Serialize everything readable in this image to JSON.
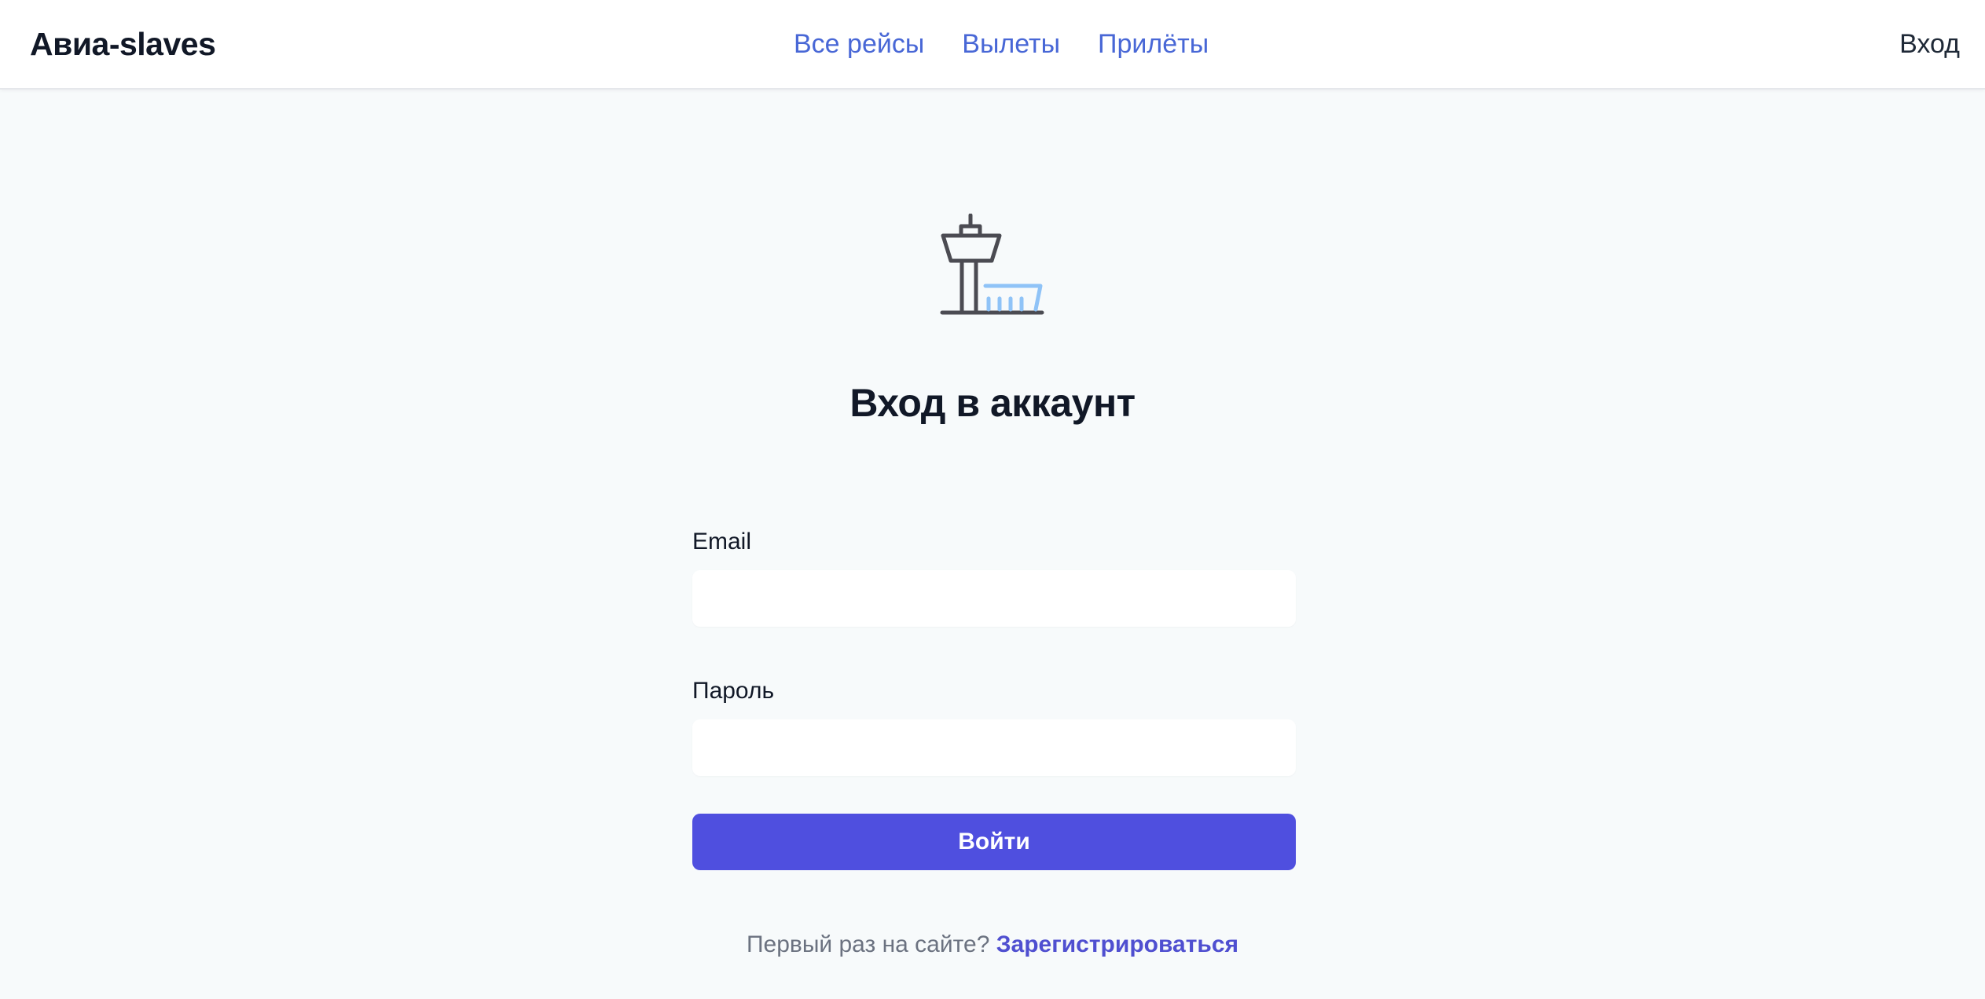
{
  "header": {
    "brand": "Авиа-slaves",
    "nav": [
      {
        "label": "Все рейсы"
      },
      {
        "label": "Вылеты"
      },
      {
        "label": "Прилёты"
      }
    ],
    "login_label": "Вход"
  },
  "main": {
    "logo_icon": "control-tower-icon",
    "title": "Вход в аккаунт",
    "form": {
      "email_label": "Email",
      "email_value": "",
      "password_label": "Пароль",
      "password_value": "",
      "submit_label": "Войти"
    },
    "register_prompt": "Первый раз на сайте?",
    "register_link": "Зарегистрироваться"
  },
  "colors": {
    "accent": "#4f4fdf",
    "nav_link": "#4867d6",
    "background": "#f7fafb",
    "icon_stroke": "#4b4b52",
    "icon_accent": "#8fc3f7"
  }
}
